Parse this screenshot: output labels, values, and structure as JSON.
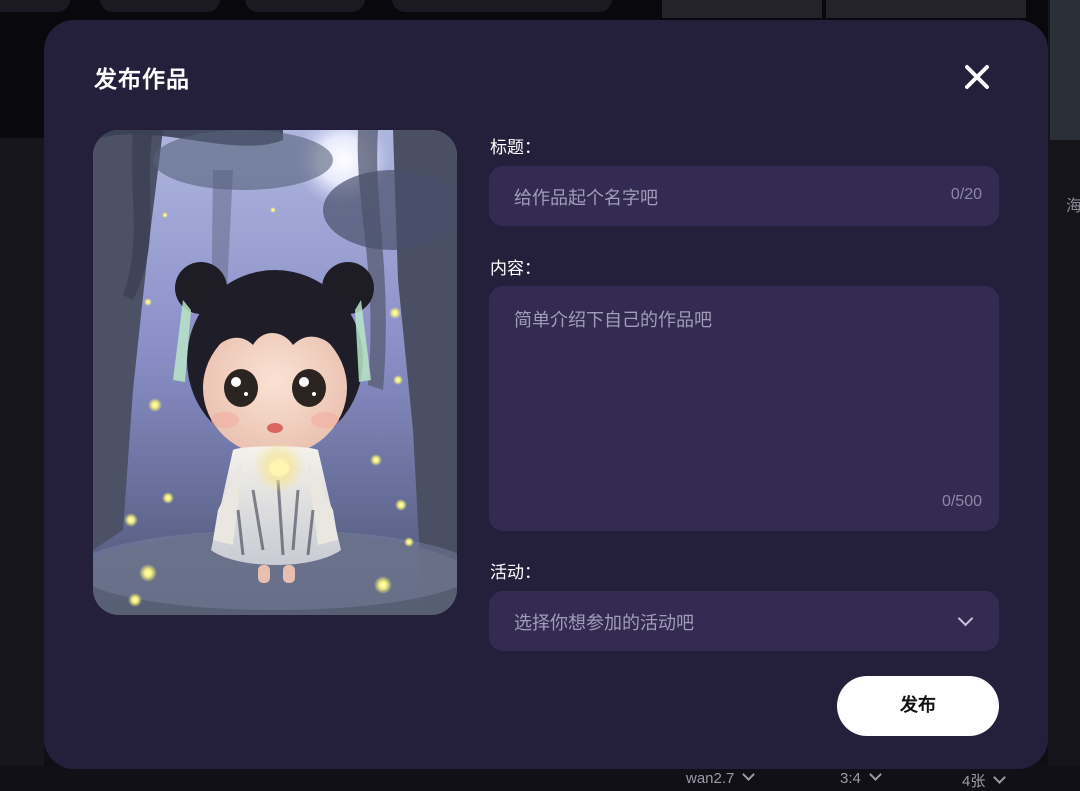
{
  "modal": {
    "title": "发布作品",
    "title_field": {
      "label": "标题：",
      "placeholder": "给作品起个名字吧",
      "counter": "0/20"
    },
    "content_field": {
      "label": "内容：",
      "placeholder": "简单介绍下自己的作品吧",
      "counter": "0/500"
    },
    "activity_field": {
      "label": "活动：",
      "placeholder": "选择你想参加的活动吧"
    },
    "publish_label": "发布",
    "close_icon": "close-icon"
  },
  "background": {
    "side_text": "海",
    "bottom_options": [
      {
        "label": "wan2.7"
      },
      {
        "label": "3:4"
      },
      {
        "label": "4张"
      }
    ]
  },
  "colors": {
    "modal_bg": "#241f3b",
    "input_bg": "#342b52",
    "placeholder": "#a19cb9",
    "button_bg": "#ffffff"
  }
}
